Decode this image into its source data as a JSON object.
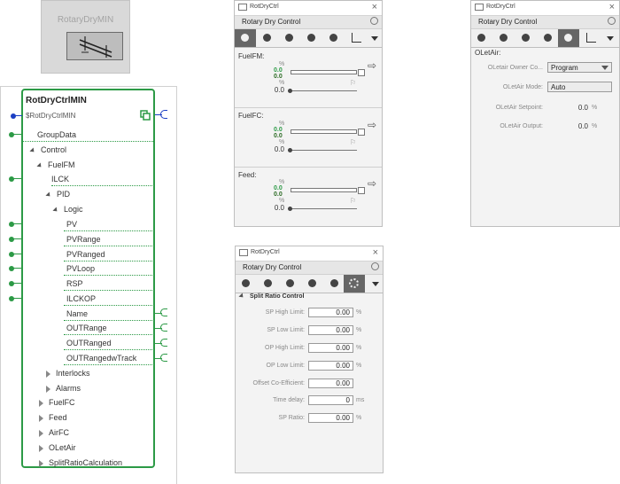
{
  "min_icon": {
    "title": "RotaryDryMIN"
  },
  "function_block": {
    "title": "RotDryCtrlMIN",
    "subtitle": "$RotDryCtrlMIN",
    "items": [
      "GroupData",
      "Control",
      "FuelFM",
      "ILCK",
      "PID",
      "Logic",
      "PV",
      "PVRange",
      "PVRanged",
      "PVLoop",
      "RSP",
      "ILCKOP",
      "Name",
      "OUTRange",
      "OUTRanged",
      "OUTRangedwTrack",
      "Interlocks",
      "Alarms",
      "FuelFC",
      "Feed",
      "AirFC",
      "OLetAir",
      "SplitRatioCalculation"
    ]
  },
  "fp1": {
    "window_title": "RotDryCtrl",
    "header": "Rotary Dry Control",
    "sections": [
      {
        "label": "FuelFM:",
        "unit1": "%",
        "v1": "0.0",
        "v2": "0.0",
        "unit2": "%",
        "v3": "0.0"
      },
      {
        "label": "FuelFC:",
        "unit1": "%",
        "v1": "0.0",
        "v2": "0.0",
        "unit2": "%",
        "v3": "0.0"
      },
      {
        "label": "Feed:",
        "unit1": "%",
        "v1": "0.0",
        "v2": "0.0",
        "unit2": "%",
        "v3": "0.0"
      }
    ]
  },
  "fp2": {
    "window_title": "RotDryCtrl",
    "header": "Rotary Dry Control",
    "section": "OLetAir:",
    "owner_label": "OLetair Owner Co...",
    "owner_value": "Program",
    "mode_label": "OLetAir Mode:",
    "mode_value": "Auto",
    "setpoint_label": "OLetAir Setpoint:",
    "setpoint_value": "0.0",
    "setpoint_unit": "%",
    "output_label": "OLetAir Output:",
    "output_value": "0.0",
    "output_unit": "%"
  },
  "fp3": {
    "window_title": "RotDryCtrl",
    "header": "Rotary Dry Control",
    "section": "Split Ratio Control",
    "rows": [
      {
        "label": "SP High Limit:",
        "value": "0.00",
        "unit": "%"
      },
      {
        "label": "SP Low Limit:",
        "value": "0.00",
        "unit": "%"
      },
      {
        "label": "OP High Limit:",
        "value": "0.00",
        "unit": "%"
      },
      {
        "label": "OP Low Limit:",
        "value": "0.00",
        "unit": "%"
      },
      {
        "label": "Offset Co-Efficient:",
        "value": "0.00",
        "unit": ""
      },
      {
        "label": "Time delay:",
        "value": "0",
        "unit": "ms"
      },
      {
        "label": "SP Ratio:",
        "value": "0.00",
        "unit": "%"
      }
    ]
  }
}
